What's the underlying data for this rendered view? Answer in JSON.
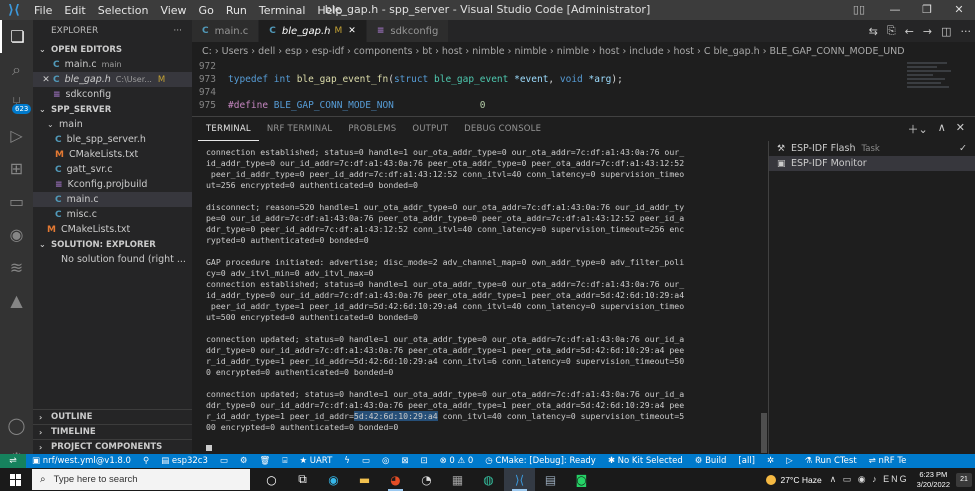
{
  "window": {
    "title": "ble_gap.h - spp_server - Visual Studio Code [Administrator]",
    "menu": [
      "File",
      "Edit",
      "Selection",
      "View",
      "Go",
      "Run",
      "Terminal",
      "Help"
    ]
  },
  "activity": {
    "badge": "623"
  },
  "sidebar": {
    "header": "EXPLORER",
    "open_editors": {
      "title": "OPEN EDITORS",
      "items": [
        {
          "icon": "C",
          "name": "main.c",
          "sub": "main",
          "modified": ""
        },
        {
          "icon": "C",
          "name": "ble_gap.h",
          "sub": "C:\\User...",
          "modified": "M"
        },
        {
          "icon": "≡",
          "name": "sdkconfig",
          "sub": "",
          "modified": ""
        }
      ]
    },
    "project": {
      "title": "SPP_SERVER",
      "folder": "main",
      "files": [
        {
          "icon": "C",
          "name": "ble_spp_server.h"
        },
        {
          "icon": "M",
          "name": "CMakeLists.txt"
        },
        {
          "icon": "C",
          "name": "gatt_svr.c"
        },
        {
          "icon": "≡",
          "name": "Kconfig.projbuild"
        },
        {
          "icon": "C",
          "name": "main.c"
        },
        {
          "icon": "C",
          "name": "misc.c"
        }
      ],
      "root_file": {
        "icon": "M",
        "name": "CMakeLists.txt"
      }
    },
    "solution": {
      "title": "SOLUTION: EXPLORER",
      "message": "No solution found (right ..."
    },
    "bottom_sections": [
      "OUTLINE",
      "TIMELINE",
      "PROJECT COMPONENTS"
    ]
  },
  "tabs": [
    {
      "icon": "C",
      "label": "main.c",
      "modified": "",
      "active": false
    },
    {
      "icon": "C",
      "label": "ble_gap.h",
      "modified": "M",
      "active": true
    },
    {
      "icon": "≡",
      "label": "sdkconfig",
      "modified": "",
      "active": false
    }
  ],
  "breadcrumbs": [
    "C:",
    "Users",
    "dell",
    "esp",
    "esp-idf",
    "components",
    "bt",
    "host",
    "nimble",
    "nimble",
    "nimble",
    "host",
    "include",
    "host",
    "C  ble_gap.h",
    "BLE_GAP_CONN_MODE_UND"
  ],
  "code": {
    "lines": [
      {
        "n": "972",
        "text": ""
      },
      {
        "n": "973",
        "text": "typedef int ble_gap_event_fn(struct ble_gap_event *event, void *arg);"
      },
      {
        "n": "974",
        "text": ""
      },
      {
        "n": "975",
        "text": "#define BLE_GAP_CONN_MODE_NON               0"
      }
    ]
  },
  "panel": {
    "tabs": [
      "TERMINAL",
      "NRF TERMINAL",
      "PROBLEMS",
      "OUTPUT",
      "DEBUG CONSOLE"
    ],
    "terminal_lines": [
      "connection established; status=0 handle=1 our_ota_addr_type=0 our_ota_addr=7c:df:a1:43:0a:76 our_",
      "id_addr_type=0 our_id_addr=7c:df:a1:43:0a:76 peer_ota_addr_type=0 peer_ota_addr=7c:df:a1:43:12:52",
      " peer_id_addr_type=0 peer_id_addr=7c:df:a1:43:12:52 conn_itvl=40 conn_latency=0 supervision_timeo",
      "ut=256 encrypted=0 authenticated=0 bonded=0",
      "",
      "disconnect; reason=520 handle=1 our_ota_addr_type=0 our_ota_addr=7c:df:a1:43:0a:76 our_id_addr_ty",
      "pe=0 our_id_addr=7c:df:a1:43:0a:76 peer_ota_addr_type=0 peer_ota_addr=7c:df:a1:43:12:52 peer_id_a",
      "ddr_type=0 peer_id_addr=7c:df:a1:43:12:52 conn_itvl=40 conn_latency=0 supervision_timeout=256 enc",
      "rypted=0 authenticated=0 bonded=0",
      "",
      "GAP procedure initiated: advertise; disc_mode=2 adv_channel_map=0 own_addr_type=0 adv_filter_poli",
      "cy=0 adv_itvl_min=0 adv_itvl_max=0",
      "connection established; status=0 handle=1 our_ota_addr_type=0 our_ota_addr=7c:df:a1:43:0a:76 our_",
      "id_addr_type=0 our_id_addr=7c:df:a1:43:0a:76 peer_ota_addr_type=1 peer_ota_addr=5d:42:6d:10:29:a4",
      " peer_id_addr_type=1 peer_id_addr=5d:42:6d:10:29:a4 conn_itvl=40 conn_latency=0 supervision_timeo",
      "ut=500 encrypted=0 authenticated=0 bonded=0",
      "",
      "connection updated; status=0 handle=1 our_ota_addr_type=0 our_ota_addr=7c:df:a1:43:0a:76 our_id_a",
      "ddr_type=0 our_id_addr=7c:df:a1:43:0a:76 peer_ota_addr_type=1 peer_ota_addr=5d:42:6d:10:29:a4 pee",
      "r_id_addr_type=1 peer_id_addr=5d:42:6d:10:29:a4 conn_itvl=6 conn_latency=0 supervision_timeout=50",
      "0 encrypted=0 authenticated=0 bonded=0",
      "",
      "connection updated; status=0 handle=1 our_ota_addr_type=0 our_ota_addr=7c:df:a1:43:0a:76 our_id_a",
      "ddr_type=0 our_id_addr=7c:df:a1:43:0a:76 peer_ota_addr_type=1 peer_ota_addr=5d:42:6d:10:29:a4 pee"
    ],
    "last_line_prefix": "r_id_addr_type=1 peer_id_addr=",
    "last_line_highlight": "5d:42:6d:10:29:a4",
    "last_line_suffix": " conn_itvl=40 conn_latency=0 supervision_timeout=5",
    "final_line": "00 encrypted=0 authenticated=0 bonded=0",
    "terminals": [
      {
        "name": "ESP-IDF Flash",
        "kind": "Task",
        "active": false
      },
      {
        "name": "ESP-IDF Monitor",
        "kind": "",
        "active": true
      }
    ]
  },
  "status": {
    "items": [
      "nrf/west.yml@v1.8.0",
      "esp32c3",
      "UART",
      "⊗ 0 ⚠ 0",
      "CMake: [Debug]: Ready",
      "No Kit Selected",
      "Build",
      "[all]",
      "Run CTest",
      "nRF Te"
    ]
  },
  "taskbar": {
    "search_placeholder": "Type here to search",
    "weather": "27°C  Haze",
    "time": "6:23 PM",
    "date": "3/20/2022",
    "notifications": "21"
  },
  "colors": {
    "accent": "#007acc",
    "remote": "#16825d",
    "modified": "#c5a334"
  }
}
